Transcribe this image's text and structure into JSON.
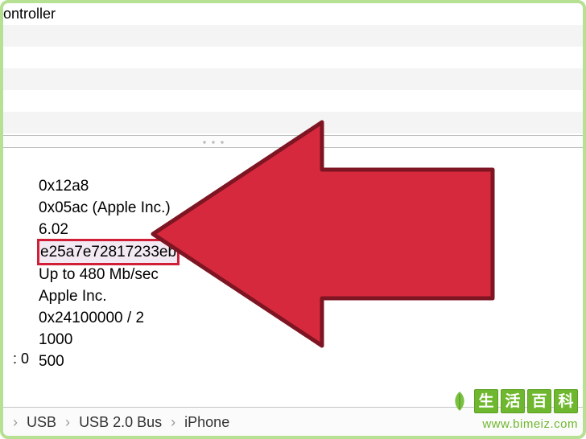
{
  "top": {
    "controller_fragment": "ontroller"
  },
  "details": {
    "product_id": "0x12a8",
    "vendor_id": "0x05ac  (Apple Inc.)",
    "version_partial": "6.02",
    "serial": "e25a7e72817233eb",
    "speed": "Up to 480 Mb/sec",
    "manufacturer": "Apple Inc.",
    "location_id": "0x24100000 / 2",
    "current_available": "1000",
    "current_required": "500"
  },
  "extra_label": ":   0",
  "breadcrumb": {
    "items": [
      "USB",
      "USB 2.0 Bus",
      "iPhone"
    ]
  },
  "watermark": {
    "chars": [
      "生",
      "活",
      "百",
      "科"
    ],
    "url": "www.bimeiz.com"
  }
}
